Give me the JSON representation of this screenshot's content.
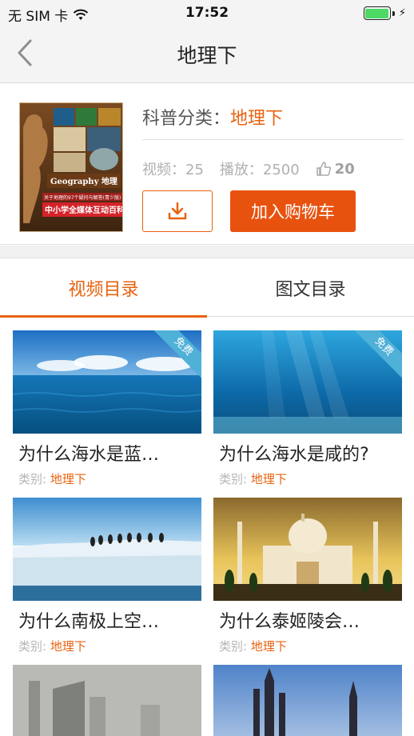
{
  "status_bar": {
    "carrier": "无 SIM 卡",
    "time": "17:52"
  },
  "nav": {
    "title": "地理下"
  },
  "product": {
    "category_label": "科普分类：",
    "category_value": "地理下",
    "videos_label": "视频：",
    "videos_count": "25",
    "plays_label": "播放：",
    "plays_count": "2500",
    "likes_count": "20",
    "add_to_cart_label": "加入购物车",
    "cover": {
      "brand_text": "Geography 地理",
      "subtitle": "中小学全媒体互动百科",
      "small_text": "关于地理的97个疑问与解答(青少版)"
    }
  },
  "tabs": [
    {
      "label": "视频目录",
      "active": true
    },
    {
      "label": "图文目录",
      "active": false
    }
  ],
  "meta_label": "类别:",
  "free_badge": "免费",
  "videos": [
    {
      "title": "为什么海水是蓝…",
      "category": "地理下",
      "free": true,
      "scene": "sea-sky"
    },
    {
      "title": "为什么海水是咸的?",
      "category": "地理下",
      "free": true,
      "scene": "underwater"
    },
    {
      "title": "为什么南极上空…",
      "category": "地理下",
      "free": false,
      "scene": "antarctic"
    },
    {
      "title": "为什么泰姬陵会…",
      "category": "地理下",
      "free": false,
      "scene": "taj-mahal"
    },
    {
      "title": "",
      "category": "",
      "free": false,
      "scene": "smog-city"
    },
    {
      "title": "",
      "category": "",
      "free": false,
      "scene": "foggy-castle"
    }
  ],
  "colors": {
    "accent": "#e8620f",
    "button_fill": "#e8520f",
    "free_badge": "#4fb0d8",
    "battery": "#4cd964"
  }
}
